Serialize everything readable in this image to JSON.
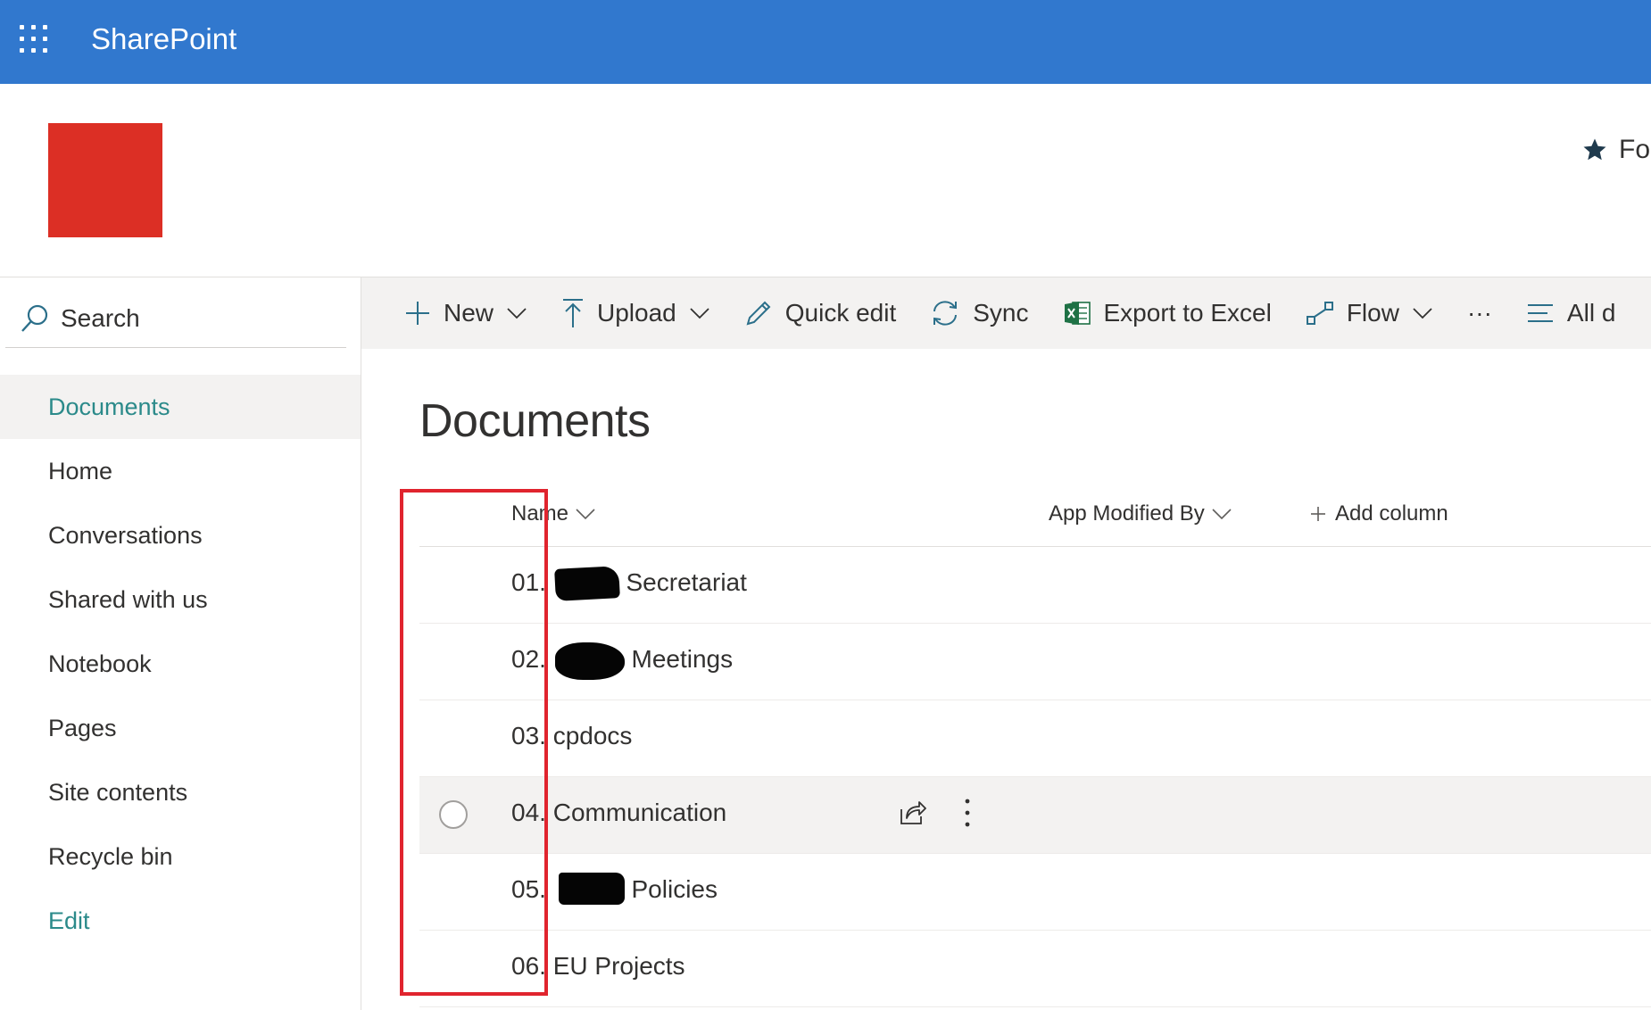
{
  "suite_bar": {
    "app_name": "SharePoint"
  },
  "site_header": {
    "follow_label": "Fo"
  },
  "left_nav": {
    "search_label": "Search",
    "items": [
      {
        "label": "Documents",
        "selected": true
      },
      {
        "label": "Home"
      },
      {
        "label": "Conversations"
      },
      {
        "label": "Shared with us"
      },
      {
        "label": "Notebook"
      },
      {
        "label": "Pages"
      },
      {
        "label": "Site contents"
      },
      {
        "label": "Recycle bin"
      },
      {
        "label": "Edit",
        "link": true
      }
    ]
  },
  "command_bar": {
    "new": "New",
    "upload": "Upload",
    "quick_edit": "Quick edit",
    "sync": "Sync",
    "export": "Export to Excel",
    "flow": "Flow",
    "more": "···",
    "view": "All d"
  },
  "library": {
    "title": "Documents",
    "columns": {
      "name": "Name",
      "modified_by": "App Modified By",
      "add_column": "Add column"
    },
    "rows": [
      {
        "prefix": "01.",
        "name": "Secretariat"
      },
      {
        "prefix": "02.",
        "name": "Meetings"
      },
      {
        "prefix": "03.",
        "name": "cpdocs"
      },
      {
        "prefix": "04.",
        "name": "Communication"
      },
      {
        "prefix": "05.",
        "name": "Policies"
      },
      {
        "prefix": "06.",
        "name": "EU Projects"
      }
    ]
  },
  "colors": {
    "brand": "#3178ce",
    "accent": "#2b8a8a",
    "logo": "#dc2f25",
    "highlight": "#e0242e"
  },
  "icons": [
    "waffle-icon",
    "star-icon",
    "search-icon",
    "plus-icon",
    "upload-icon",
    "pencil-icon",
    "sync-icon",
    "excel-icon",
    "flow-icon",
    "view-list-icon",
    "chevron-down-icon",
    "share-icon",
    "more-vertical-icon"
  ]
}
